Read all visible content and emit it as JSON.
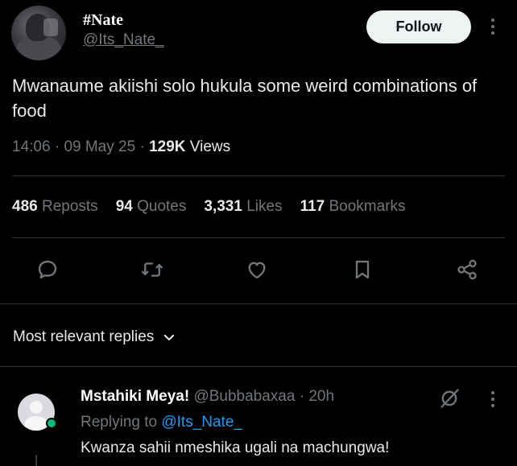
{
  "author": {
    "display_name": "#Nate",
    "handle": "@Its_Nate_",
    "follow_label": "Follow"
  },
  "tweet": {
    "text": "Mwanaume akiishi solo hukula some weird combinations of food",
    "time": "14:06",
    "date": "09 May 25",
    "views_count": "129K",
    "views_label": "Views",
    "separator": "·"
  },
  "stats": [
    {
      "count": "486",
      "label": "Reposts"
    },
    {
      "count": "94",
      "label": "Quotes"
    },
    {
      "count": "3,331",
      "label": "Likes"
    },
    {
      "count": "117",
      "label": "Bookmarks"
    }
  ],
  "actions": [
    "reply-icon",
    "repost-icon",
    "like-icon",
    "bookmark-icon",
    "share-icon"
  ],
  "replies_sort": {
    "label": "Most relevant replies"
  },
  "reply": {
    "name": "Mstahiki Meya!",
    "handle": "@Bubbabaxaa",
    "separator": "·",
    "time": "20h",
    "replying_prefix": "Replying to",
    "replying_handle": "@Its_Nate_",
    "text": "Kwanza sahii nmeshika ugali na machungwa!"
  },
  "colors": {
    "background": "#000000",
    "text_primary": "#e7e9ea",
    "text_secondary": "#71767b",
    "link": "#1d9bf0",
    "divider": "#2f3336",
    "online": "#00ba7c"
  }
}
